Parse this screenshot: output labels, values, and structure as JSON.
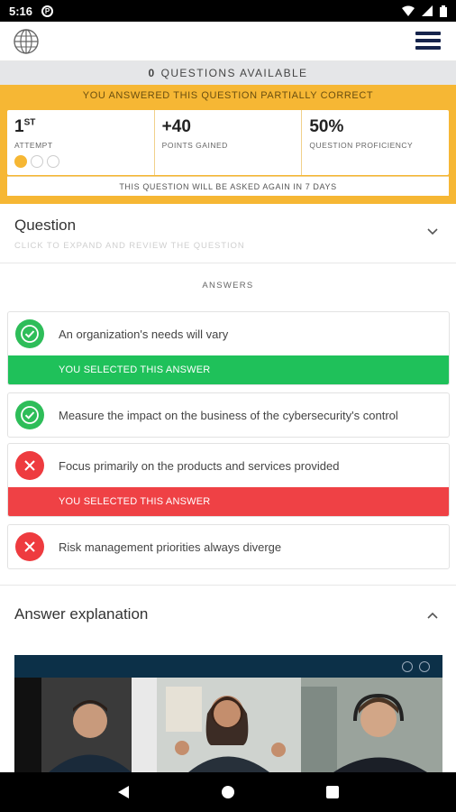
{
  "status": {
    "time": "5:16",
    "notif_glyph": "⊗"
  },
  "appbar": {
    "logo_icon": "globe-icon",
    "menu_icon": "hamburger-menu-icon"
  },
  "questions_bar": {
    "count": "0",
    "label": "QUESTIONS AVAILABLE"
  },
  "result": {
    "banner": "YOU ANSWERED THIS QUESTION PARTIALLY CORRECT",
    "attempt": {
      "value": "1",
      "suffix": "ST",
      "label": "ATTEMPT",
      "dots_filled": 1,
      "dots_total": 3
    },
    "points": {
      "value": "+40",
      "label": "POINTS GAINED"
    },
    "proficiency": {
      "value": "50%",
      "label": "QUESTION PROFICIENCY"
    },
    "repeat_note": "THIS QUESTION WILL BE ASKED AGAIN IN 7 DAYS"
  },
  "question": {
    "title": "Question",
    "subtitle": "CLICK TO EXPAND AND REVIEW THE QUESTION"
  },
  "answers": {
    "heading": "ANSWERS",
    "items": [
      {
        "text": "An organization's needs will vary",
        "correct": true,
        "selected_label": "YOU SELECTED THIS ANSWER"
      },
      {
        "text": "Measure the impact on the business of the cybersecurity's control",
        "correct": true,
        "selected_label": ""
      },
      {
        "text": "Focus primarily on the products and services provided",
        "correct": false,
        "selected_label": "YOU SELECTED THIS ANSWER"
      },
      {
        "text": "Risk management priorities always diverge",
        "correct": false,
        "selected_label": ""
      }
    ]
  },
  "explanation": {
    "title": "Answer explanation"
  },
  "colors": {
    "accent": "#f6b734",
    "correct": "#1fc15a",
    "wrong": "#ef4145",
    "navy": "#16244c"
  }
}
